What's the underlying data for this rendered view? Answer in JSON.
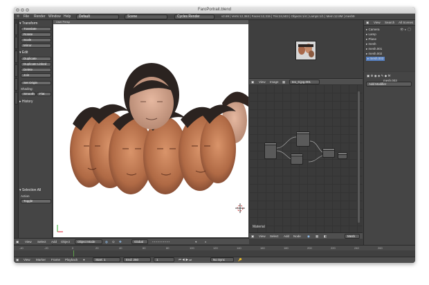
{
  "window": {
    "title": "FaroPortrait.blend"
  },
  "menu": {
    "items": [
      "File",
      "Render",
      "Window",
      "Help"
    ]
  },
  "infobar": {
    "screen_layout": "Default",
    "scene": "Scene",
    "render_engine": "Cycles Render",
    "stats": "v2.69 | Verts:12,363 | Faces:12,315 | Tris:24,503 | Objects:1/4 | Lamps:1/1 | Mem:12.8M | mesh9"
  },
  "toolshelf": {
    "transform_header": "▾ Transform",
    "transform_buttons": [
      "Translate",
      "Rotate",
      "Scale",
      "Mirror"
    ],
    "edit_header": "▾ Edit",
    "edit_buttons": [
      "Duplicate",
      "Duplicate Linked",
      "Delete",
      "Join"
    ],
    "set_origin": "Set Origin",
    "shading_label": "Shading:",
    "shading_smooth": "Smooth",
    "shading_flat": "Flat",
    "history_header": "▸ History",
    "last_op_header": "▾ Selection All",
    "action_label": "Action",
    "action_value": "Toggle"
  },
  "viewport": {
    "header_text": "User Persp",
    "header": {
      "view": "View",
      "select": "Select",
      "add": "Add",
      "object": "Object",
      "mode": "Object Mode",
      "global": "Global"
    }
  },
  "image_editor": {
    "header": {
      "view": "View",
      "image": "Image",
      "image_name": "tex_0.jpg.001"
    }
  },
  "node_editor": {
    "material_label": "Material",
    "header": {
      "view": "View",
      "select": "Select",
      "add": "Add",
      "node": "Node",
      "mode": "Mesh"
    }
  },
  "outliner": {
    "header": {
      "view": "View",
      "search": "Search",
      "scenes": "All Scenes"
    },
    "items": [
      "Camera",
      "Lamp",
      "Plane",
      "mesh",
      "mesh.001",
      "mesh.002",
      "mesh.003"
    ]
  },
  "properties": {
    "object_name": "mesh.003",
    "add_modifier": "Add Modifier"
  },
  "timeline": {
    "ruler_ticks": [
      "-40",
      "-20",
      "0",
      "20",
      "40",
      "60",
      "80",
      "100",
      "120",
      "140",
      "160",
      "180",
      "200",
      "220",
      "240",
      "260"
    ],
    "menu": {
      "view": "View",
      "marker": "Marker",
      "frame": "Frame",
      "playback": "Playback"
    },
    "start_label": "Start:",
    "start_value": "1",
    "end_label": "End:",
    "end_value": "250",
    "current_frame": "1",
    "sync": "No Sync"
  },
  "colors": {
    "window_bg": "#3d3d3d",
    "accent": "#5680c2",
    "frame_marker": "#5fa14a"
  }
}
